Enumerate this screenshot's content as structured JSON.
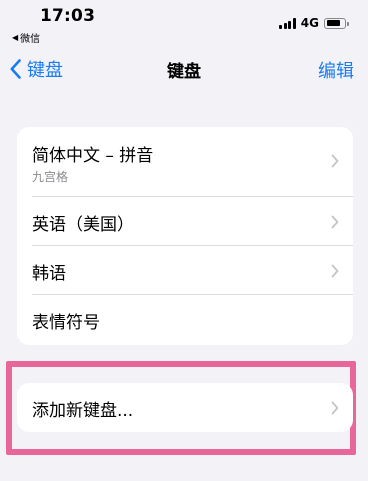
{
  "status_bar": {
    "time": "17:03",
    "back_app": "微信",
    "network": "4G"
  },
  "nav": {
    "back_label": "键盘",
    "title": "键盘",
    "edit_label": "编辑"
  },
  "keyboards": [
    {
      "label": "简体中文 – 拼音",
      "sublabel": "九宫格"
    },
    {
      "label": "英语（美国）"
    },
    {
      "label": "韩语"
    },
    {
      "label": "表情符号"
    }
  ],
  "add_keyboard": {
    "label": "添加新键盘..."
  },
  "colors": {
    "accent": "#1a7cf5",
    "highlight": "#e9669a",
    "background": "#f2f2f7"
  }
}
